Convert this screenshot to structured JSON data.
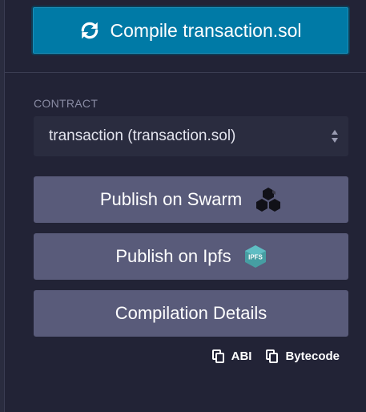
{
  "compile": {
    "label": "Compile transaction.sol",
    "icon": "refresh-icon",
    "color": "#007aa6"
  },
  "contract": {
    "section_label": "CONTRACT",
    "selected": "transaction (transaction.sol)"
  },
  "actions": {
    "swarm_label": "Publish on Swarm",
    "swarm_icon": "swarm-logo-icon",
    "ipfs_label": "Publish on Ipfs",
    "ipfs_icon": "ipfs-logo-icon",
    "ipfs_badge": "IPFS",
    "details_label": "Compilation Details"
  },
  "copy": {
    "abi_label": "ABI",
    "bytecode_label": "Bytecode",
    "icon": "copy-icon"
  },
  "colors": {
    "background": "#222336",
    "button": "#595b7a",
    "select": "#2a2c3f",
    "muted_text": "#8a8ca4"
  }
}
